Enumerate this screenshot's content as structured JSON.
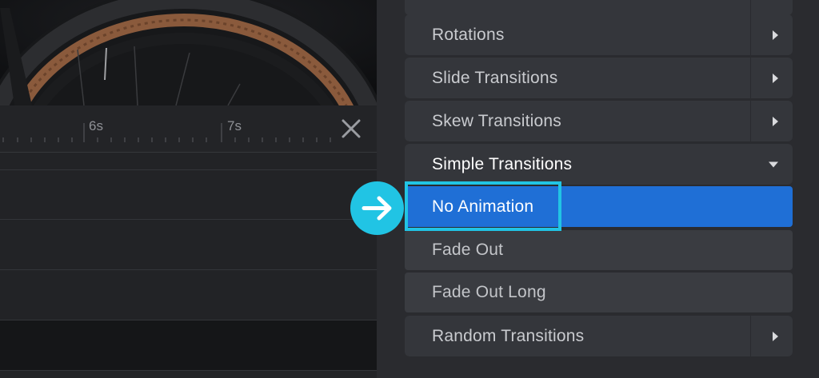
{
  "timeline": {
    "ticks": [
      "6s",
      "7s"
    ]
  },
  "menu": {
    "items": [
      {
        "label": "Rotations",
        "arrow": "right"
      },
      {
        "label": "Slide Transitions",
        "arrow": "right"
      },
      {
        "label": "Skew Transitions",
        "arrow": "right"
      },
      {
        "label": "Simple Transitions",
        "arrow": "down"
      },
      {
        "label": "No Animation"
      },
      {
        "label": "Fade Out"
      },
      {
        "label": "Fade Out Long"
      },
      {
        "label": "Random Transitions",
        "arrow": "right"
      }
    ]
  },
  "colors": {
    "accent": "#1f6fd6",
    "highlight": "#21c4e4",
    "panel_bg": "#2a2b2f",
    "item_bg": "#34363b"
  },
  "icons": {
    "close": "close-icon",
    "pointer": "arrow-right-icon"
  }
}
